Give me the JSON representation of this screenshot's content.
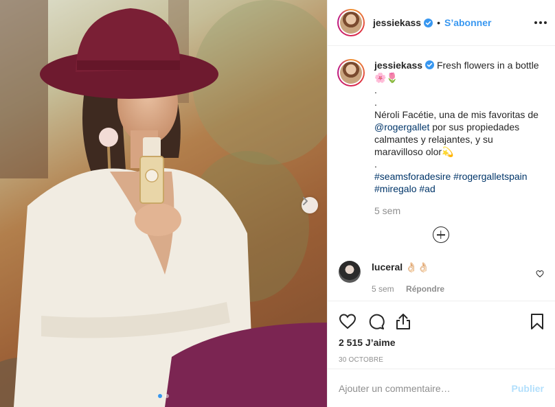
{
  "photo": {
    "alt_icon": "chevron-right-icon",
    "carousel_dots": 2,
    "active_dot": 0
  },
  "header": {
    "username": "jessiekass",
    "separator": "•",
    "follow_label": "S’abonner",
    "more_icon": "more-horizontal-icon"
  },
  "caption": {
    "username": "jessiekass",
    "first_line": "Fresh flowers in a bottle",
    "emoji_line": "🌸🌷",
    "dot1": ".",
    "dot2": ".",
    "text1": "Néroli Facétie, una de mis favoritas de",
    "mention": "@rogergallet",
    "text2": "por sus propiedades calmantes y relajantes, y su maravilloso olor",
    "sparkle": "💫",
    "dot3": ".",
    "hashtags_line1": "#seamsforadesire #rogergalletspain",
    "hashtags_line2": "#miregalo #ad",
    "time": "5 sem"
  },
  "comment": {
    "username": "luceral",
    "text": "👌🏻👌🏻",
    "time": "5 sem",
    "reply_label": "Répondre"
  },
  "actions": {
    "likes": "2 515 J’aime",
    "date": "30 OCTOBRE"
  },
  "add_comment": {
    "placeholder": "Ajouter un commentaire…",
    "post_label": "Publier"
  },
  "colors": {
    "accent": "#3897f0",
    "hat": "#7a1f35",
    "trousers": "#7b2552",
    "sweater": "#f1ece2"
  }
}
